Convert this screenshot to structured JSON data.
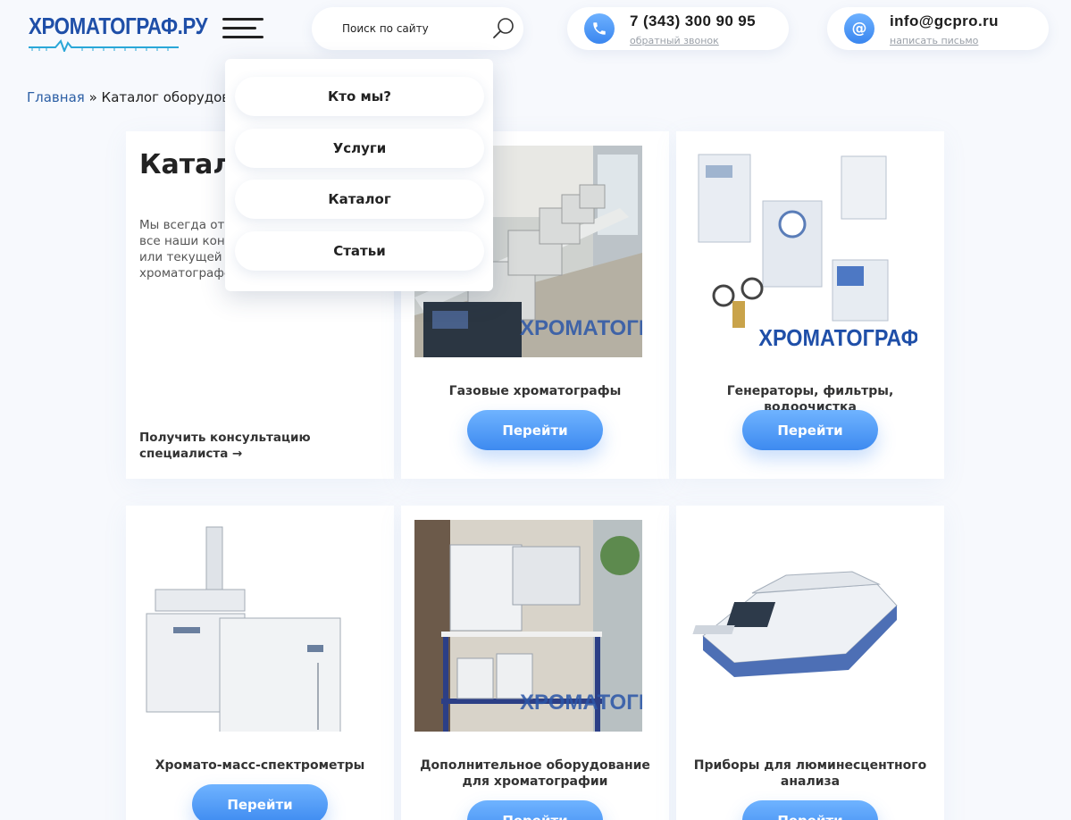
{
  "header": {
    "logo_text": "ХРОМАТОГРАФ.РУ",
    "menu_icon": "hamburger-icon",
    "search": {
      "placeholder": "Поиск по сайту",
      "icon": "search-icon"
    },
    "phone": {
      "number": "7 (343) 300 90 95",
      "link": "обратный звонок",
      "icon": "phone-icon"
    },
    "email": {
      "address": "info@gcpro.ru",
      "link": "написать письмо",
      "icon": "at-icon"
    },
    "accent_color": "#3d8af0"
  },
  "menu": {
    "items": [
      {
        "label": "Кто мы?"
      },
      {
        "label": "Услуги"
      },
      {
        "label": "Каталог"
      },
      {
        "label": "Статьи"
      }
    ]
  },
  "breadcrumb": {
    "home": "Главная",
    "separator": "»",
    "current": "Каталог оборудования"
  },
  "intro": {
    "title": "Каталог",
    "text": "Мы всегда открыты для общения, все наши консультации по подбору или текущей работе на хроматографе у нас бесплатны!",
    "consult_link": "Получить консультацию специалиста →"
  },
  "cards": [
    {
      "title": "Газовые хроматографы",
      "button": "Перейти",
      "image": "gas-chromatographs-photo"
    },
    {
      "title": "Генераторы, фильтры, водоочистка",
      "button": "Перейти",
      "image": "generators-photo"
    },
    {
      "title": "Хромато-масс-спектрометры",
      "button": "Перейти",
      "image": "mass-spectrometer-photo"
    },
    {
      "title": "Дополнительное оборудование для хроматографии",
      "button": "Перейти",
      "image": "extra-equipment-photo"
    },
    {
      "title": "Приборы для люминесцентного анализа",
      "button": "Перейти",
      "image": "luminescent-analyzer-photo"
    }
  ]
}
